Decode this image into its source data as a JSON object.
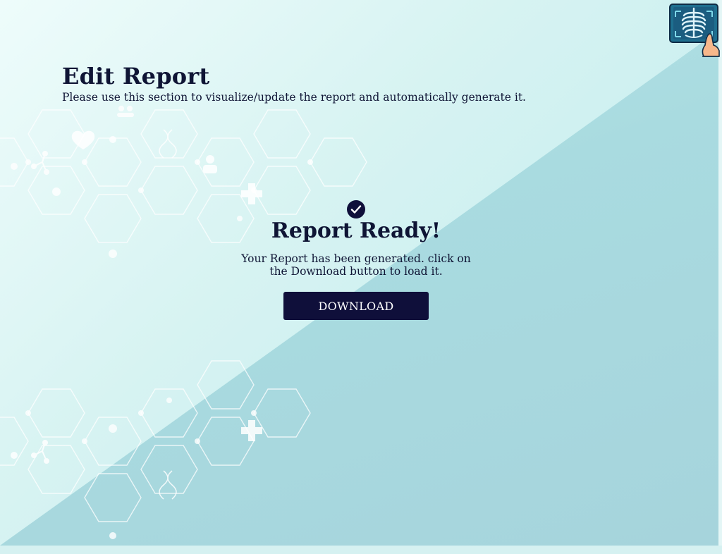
{
  "header": {
    "title": "Edit Report",
    "subtitle": "Please use this section to visualize/update the report and automatically generate it."
  },
  "logo": {
    "icon": "xray-chest-icon"
  },
  "status": {
    "icon": "check-circle-icon",
    "title": "Report Ready!",
    "message": "Your Report has been generated. click on the Download button to load it.",
    "button_label": "DOWNLOAD"
  },
  "colors": {
    "primary": "#0f0f3a",
    "text": "#0f1535",
    "background": "#d7f3f2",
    "accent_panel": "#a9dbe0"
  }
}
